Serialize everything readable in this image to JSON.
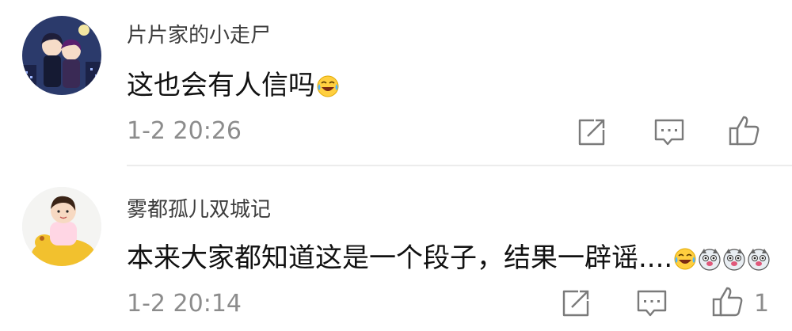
{
  "comments": [
    {
      "username": "片片家的小走尸",
      "text": "这也会有人信吗",
      "emojis": [
        "laugh-tears-emoji"
      ],
      "time": "1-2 20:26",
      "like_count": ""
    },
    {
      "username": "雾都孤儿双城记",
      "text": "本来大家都知道这是一个段子，结果一辟谣....",
      "emojis": [
        "laugh-tears-emoji",
        "dog-face-emoji",
        "dog-face-emoji",
        "dog-face-emoji"
      ],
      "time": "1-2 20:14",
      "like_count": "1"
    }
  ],
  "colors": {
    "meta_text": "#8c8c8c",
    "icon_stroke": "#7a7a7a",
    "divider": "#ececec"
  }
}
